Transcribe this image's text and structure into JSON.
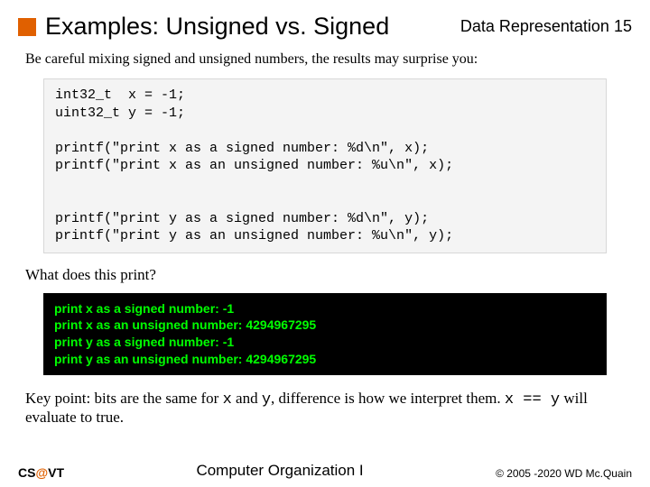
{
  "header": {
    "title": "Examples: Unsigned vs. Signed",
    "chapter": "Data Representation",
    "page": "15"
  },
  "intro": "Be careful mixing signed and unsigned numbers, the results may surprise you:",
  "code": "int32_t  x = -1;\nuint32_t y = -1;\n\nprintf(\"print x as a signed number: %d\\n\", x);\nprintf(\"print x as an unsigned number: %u\\n\", x);\n\n\nprintf(\"print y as a signed number: %d\\n\", y);\nprintf(\"print y as an unsigned number: %u\\n\", y);",
  "question": "What does this print?",
  "output": [
    "print x as a signed number: -1",
    "print x as an unsigned number: 4294967295",
    "print y as a signed number: -1",
    "print y as an unsigned number: 4294967295"
  ],
  "keypoint": {
    "pre": "Key point: bits are the same for ",
    "x": "x",
    "mid1": " and ",
    "y": "y",
    "mid2": ", difference is how we interpret them. ",
    "expr": "x == y",
    "post": " will evaluate to true."
  },
  "footer": {
    "left_cs": "CS",
    "left_at": "@",
    "left_vt": "VT",
    "center": "Computer Organization I",
    "right": "© 2005 -2020 WD Mc.Quain"
  }
}
